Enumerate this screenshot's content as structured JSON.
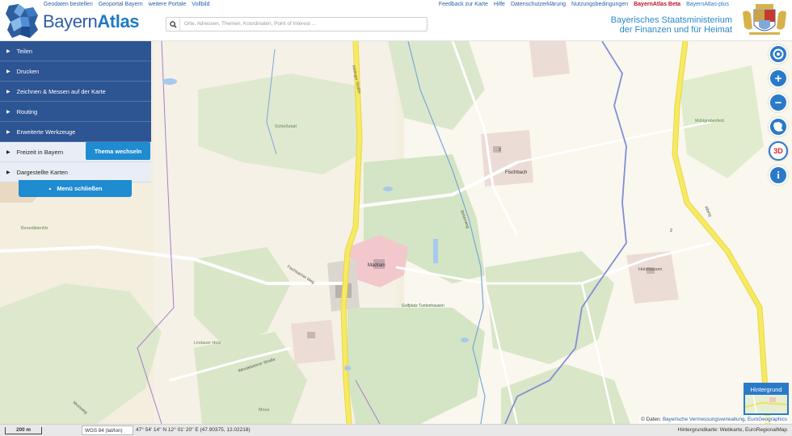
{
  "header": {
    "links_left": [
      "Geodaten bestellen",
      "Geoportal Bayern",
      "weitere Portale",
      "Vollbild"
    ],
    "links_right": [
      "Feedback zur Karte",
      "Hilfe",
      "Datenschutzerklärung",
      "Nutzungsbedingungen"
    ],
    "beta_link": "BayernAtlas Beta",
    "plus_link": "BayernAtlas-plus",
    "logo_part1": "Bayern",
    "logo_part2": "Atlas",
    "ministry_line1": "Bayerisches Staatsministerium",
    "ministry_line2": "der Finanzen und für Heimat"
  },
  "search": {
    "placeholder": "Orte, Adressen, Themen, Koordinaten, Point of Interest ..."
  },
  "menu": {
    "items": [
      {
        "label": "Teilen"
      },
      {
        "label": "Drucken"
      },
      {
        "label": "Zeichnen & Messen auf der Karte"
      },
      {
        "label": "Routing"
      },
      {
        "label": "Erweiterte Werkzeuge"
      },
      {
        "label": "Freizeit in Bayern"
      },
      {
        "label": "Dargestellte Karten"
      }
    ],
    "thema_button": "Thema wechseln",
    "close_button": "Menü schließen"
  },
  "tools": {
    "three_d": "3D",
    "info": "i"
  },
  "map_labels": {
    "place_1": "Madrain",
    "place_2": "Fischbach",
    "place_3": "Holzhausen",
    "field_1": "Schießstatt",
    "field_2": "Benediktenfilz",
    "golf": "Golfplatz Tuntenhausen",
    "road_1": "Aiblinger Straße",
    "road_2": "Wendelsteiner Straße",
    "road_3": "Fischbacher Weg",
    "road_4": "Birkenweg",
    "area_1": "Lindauer Holz",
    "area_2": "Mühlgrabenfeld",
    "area_3": "Moos",
    "road_5": "Albing",
    "road_6": "Moosweg",
    "num_1": "2",
    "num_2": "2"
  },
  "background": {
    "label": "Hintergrund"
  },
  "attribution": {
    "prefix": "© Daten: ",
    "link": "Bayerische Vermessungsverwaltung, EuroGeographics"
  },
  "status": {
    "scale": "200 m",
    "crs": "WGS 84 (lat/lon)",
    "coords": "47° 54' 14'' N 12° 01' 20'' E (47.90375, 12.02218)",
    "background_map": "Hintergrundkarte: Webkarte, EuroRegionalMap"
  },
  "colors": {
    "menu_blue": "#2d5493",
    "accent_blue": "#1f8bd0",
    "beta_red": "#c0102a",
    "road_yellow": "#f2e34a"
  }
}
